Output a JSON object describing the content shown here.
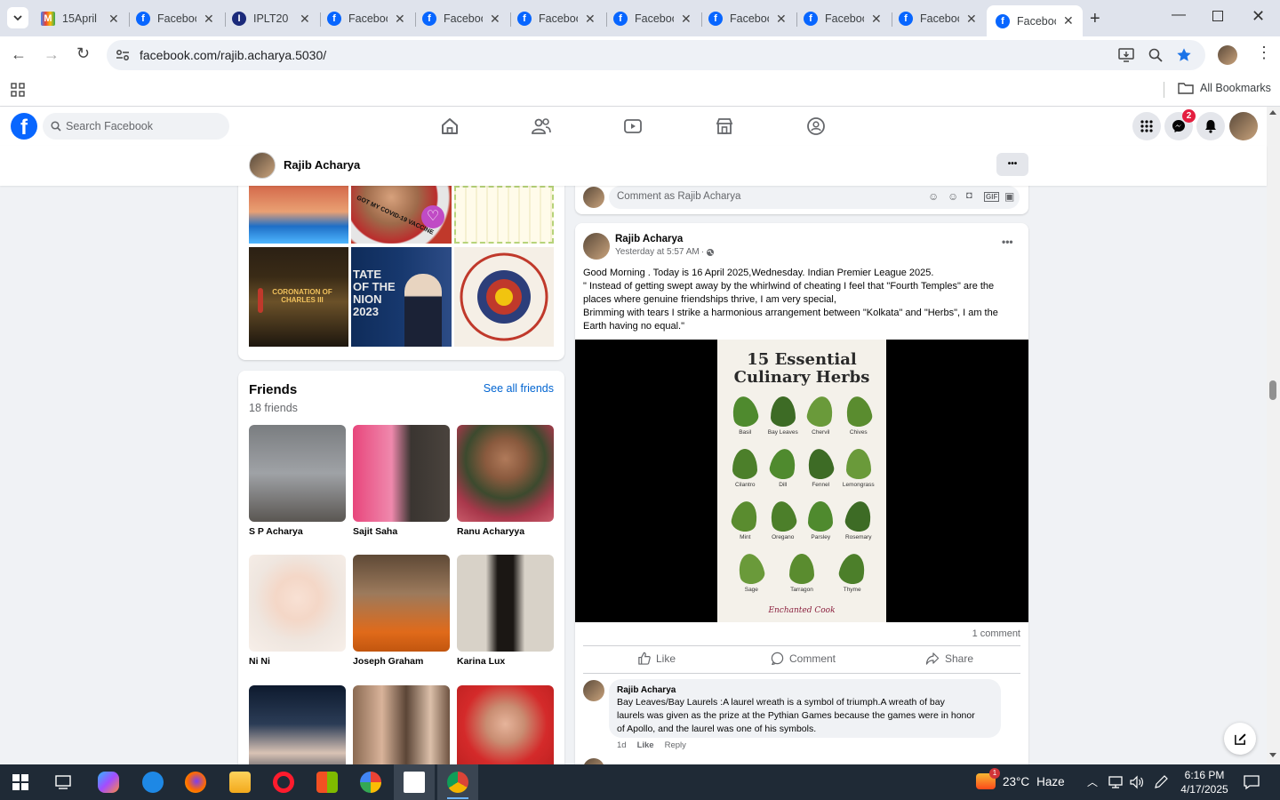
{
  "browser": {
    "tabs": [
      {
        "title": "15April",
        "icon": "gmail-icon"
      },
      {
        "title": "Facebook",
        "icon": "facebook-icon"
      },
      {
        "title": "IPLT20",
        "icon": "iplt20-icon"
      },
      {
        "title": "Facebook",
        "icon": "facebook-icon"
      },
      {
        "title": "Facebook",
        "icon": "facebook-icon"
      },
      {
        "title": "Facebook",
        "icon": "facebook-icon"
      },
      {
        "title": "Facebook",
        "icon": "facebook-icon"
      },
      {
        "title": "Facebook",
        "icon": "facebook-icon"
      },
      {
        "title": "Facebook",
        "icon": "facebook-icon"
      },
      {
        "title": "Facebook",
        "icon": "facebook-icon"
      },
      {
        "title": "Facebook",
        "icon": "facebook-icon",
        "active": true
      }
    ],
    "url": "facebook.com/rajib.acharya.5030/",
    "bookmarks_label": "All Bookmarks"
  },
  "fb": {
    "search_placeholder": "Search Facebook",
    "messenger_badge": "2",
    "profile_name": "Rajib Acharya",
    "more_label": "•••"
  },
  "photos": {
    "tiles": [
      {
        "caption": ""
      },
      {
        "caption": "GOT MY COVID-19 VACCINE"
      },
      {
        "caption": ""
      },
      {
        "caption": "CORONATION OF CHARLES III"
      },
      {
        "caption": "TATE OF THE NION 2023"
      },
      {
        "caption": "KING CHARLES III CORONATION • 6TH MAY 2023"
      }
    ]
  },
  "friends": {
    "title": "Friends",
    "count": "18 friends",
    "see_all": "See all friends",
    "list": [
      {
        "name": "S P Acharya"
      },
      {
        "name": "Sajit Saha"
      },
      {
        "name": "Ranu Acharyya"
      },
      {
        "name": "Ni Ni"
      },
      {
        "name": "Joseph Graham"
      },
      {
        "name": "Karina Lux"
      },
      {
        "name": ""
      },
      {
        "name": ""
      },
      {
        "name": ""
      }
    ]
  },
  "composer": {
    "placeholder": "Comment as Rajib Acharya"
  },
  "post": {
    "author": "Rajib Acharya",
    "time": "Yesterday at 5:57 AM",
    "separator": "·",
    "lines": [
      "Good Morning . Today is 16 April 2025,Wednesday. Indian Premier League 2025.",
      "\" Instead of getting swept away by the whirlwind of cheating I feel that \"Fourth Temples\" are the",
      "places where genuine friendships thrive, I am very special,",
      "Brimming with tears I strike a harmonious arrangement between \"Kolkata\" and \"Herbs\", I am the",
      "Earth having no equal.\""
    ],
    "image": {
      "title_line1": "15 Essential",
      "title_line2": "Culinary Herbs",
      "herbs": [
        "Basil",
        "Bay Leaves",
        "Chervil",
        "Chives",
        "Cilantro",
        "Dill",
        "Fennel",
        "Lemongrass",
        "Mint",
        "Oregano",
        "Parsley",
        "Rosemary",
        "Sage",
        "Tarragon",
        "Thyme"
      ],
      "brand": "Enchanted Cook"
    },
    "comment_count": "1 comment",
    "actions": {
      "like": "Like",
      "comment": "Comment",
      "share": "Share"
    },
    "comment": {
      "author": "Rajib Acharya",
      "text_lines": [
        "Bay Leaves/Bay Laurels :A laurel wreath is a symbol of triumph.A wreath of bay",
        "laurels was given as the prize at the Pythian Games because the games were in honor",
        "of Apollo, and the laurel was one of his symbols."
      ],
      "age": "1d",
      "like": "Like",
      "reply": "Reply"
    }
  },
  "taskbar": {
    "weather_temp": "23°C",
    "weather_cond": "Haze",
    "weather_badge": "1",
    "time": "6:16 PM",
    "date": "4/17/2025"
  }
}
